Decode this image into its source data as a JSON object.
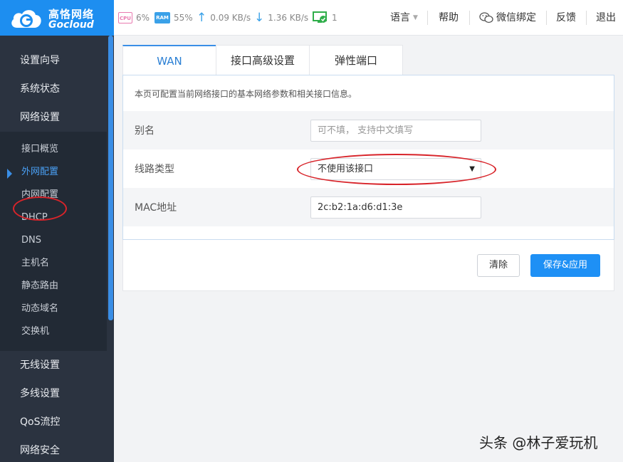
{
  "brand": {
    "name_cn": "高恪网络",
    "name_en": "Gocloud",
    "color": "#1d8ef0"
  },
  "status": {
    "cpu_chip": "CPU",
    "cpu": "6%",
    "ram_chip": "RAM",
    "ram": "55%",
    "upload": "0.09 KB/s",
    "download": "1.36 KB/s",
    "devices": "1"
  },
  "topnav": {
    "language": "语言",
    "help": "帮助",
    "wechat": "微信绑定",
    "feedback": "反馈",
    "logout": "退出"
  },
  "sidebar": {
    "top_items": [
      "设置向导",
      "系统状态",
      "网络设置"
    ],
    "sub_items": [
      "接口概览",
      "外网配置",
      "内网配置",
      "DHCP",
      "DNS",
      "主机名",
      "静态路由",
      "动态域名",
      "交换机"
    ],
    "active_sub": "外网配置",
    "bottom_items": [
      "无线设置",
      "多线设置",
      "QoS流控",
      "网络安全"
    ]
  },
  "tabs": [
    "WAN",
    "接口高级设置",
    "弹性端口"
  ],
  "form": {
    "description": "本页可配置当前网络接口的基本网络参数和相关接口信息。",
    "alias_label": "别名",
    "alias_placeholder": "可不填， 支持中文填写",
    "line_type_label": "线路类型",
    "line_type_value": "不使用该接口",
    "mac_label": "MAC地址",
    "mac_value": "2c:b2:1a:d6:d1:3e"
  },
  "buttons": {
    "clear": "清除",
    "save": "保存&应用"
  },
  "watermark": "头条 @林子爱玩机",
  "colors": {
    "accent": "#1e90f5",
    "sidebar_bg": "#222a35",
    "annotation": "#d8242a"
  }
}
